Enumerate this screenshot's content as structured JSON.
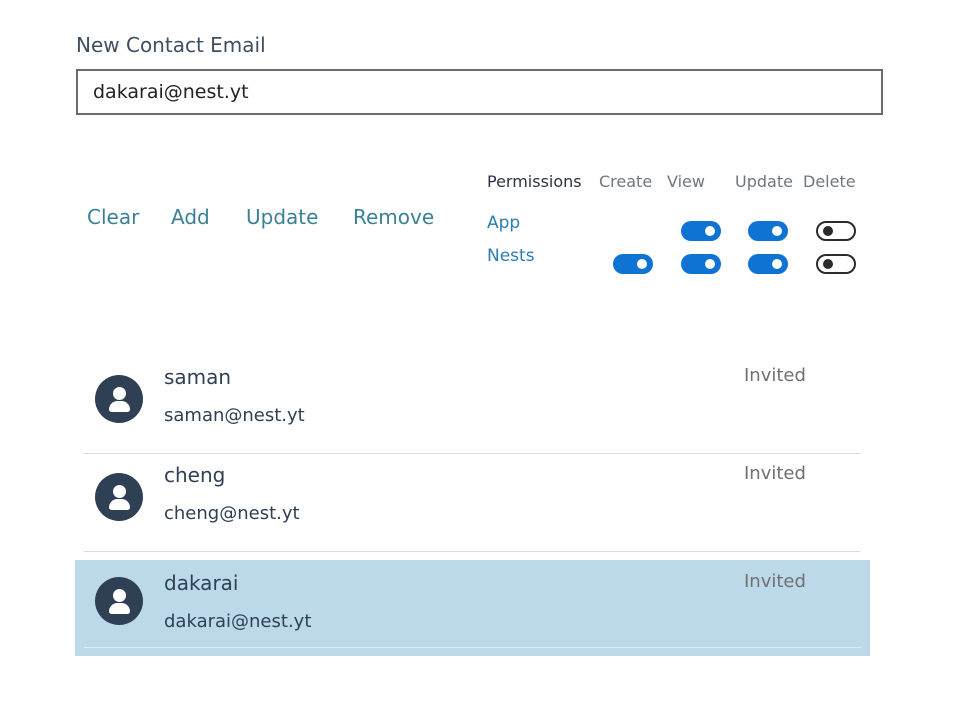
{
  "form": {
    "email_label": "New Contact Email",
    "email_value": "dakarai@nest.yt"
  },
  "actions": {
    "clear": "Clear",
    "add": "Add",
    "update": "Update",
    "remove": "Remove"
  },
  "permissions": {
    "header": "Permissions",
    "columns": [
      "Create",
      "View",
      "Update",
      "Delete"
    ],
    "rows": [
      {
        "label": "App",
        "create": null,
        "view": true,
        "update": true,
        "delete": false
      },
      {
        "label": "Nests",
        "create": true,
        "view": true,
        "update": true,
        "delete": false
      }
    ]
  },
  "contacts": [
    {
      "name": "saman",
      "email": "saman@nest.yt",
      "status": "Invited",
      "selected": false
    },
    {
      "name": "cheng",
      "email": "cheng@nest.yt",
      "status": "Invited",
      "selected": false
    },
    {
      "name": "dakarai",
      "email": "dakarai@nest.yt",
      "status": "Invited",
      "selected": true
    }
  ],
  "colors": {
    "accent": "#0f73d4",
    "action_link": "#3a8196",
    "selected_row": "#bcd9ea",
    "avatar": "#2f3f54"
  },
  "icons": {
    "avatar": "user-avatar-icon"
  }
}
